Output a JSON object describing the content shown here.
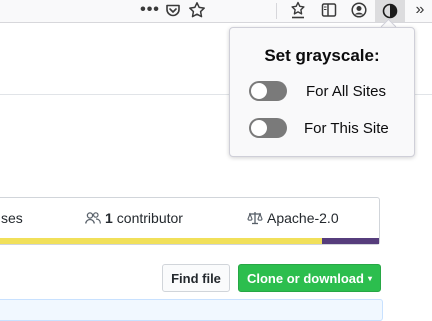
{
  "toolbar": {
    "more_label": "•••",
    "overflow_label": "»",
    "icons": [
      "more-actions-icon",
      "pocket-icon",
      "bookmark-star-icon",
      "reading-list-star-icon",
      "library-icon",
      "account-icon",
      "grayscale-extension-icon",
      "overflow-chevron-icon"
    ]
  },
  "repo": {
    "licenses_fragment": "ses",
    "contributors_count": "1",
    "contributors_label": "contributor",
    "license_name": "Apache-2.0",
    "language_colors": [
      "#f1e05a",
      "#563d7c"
    ],
    "find_file_label": "Find file",
    "clone_label": "Clone or download",
    "clone_caret": "▾"
  },
  "popup": {
    "title": "Set grayscale:",
    "options": [
      {
        "label": "For All Sites",
        "enabled": false
      },
      {
        "label": "For This Site",
        "enabled": false
      }
    ]
  },
  "colors": {
    "clone_button": "#2cbe4e",
    "toggle_off": "#7a7a7a"
  }
}
